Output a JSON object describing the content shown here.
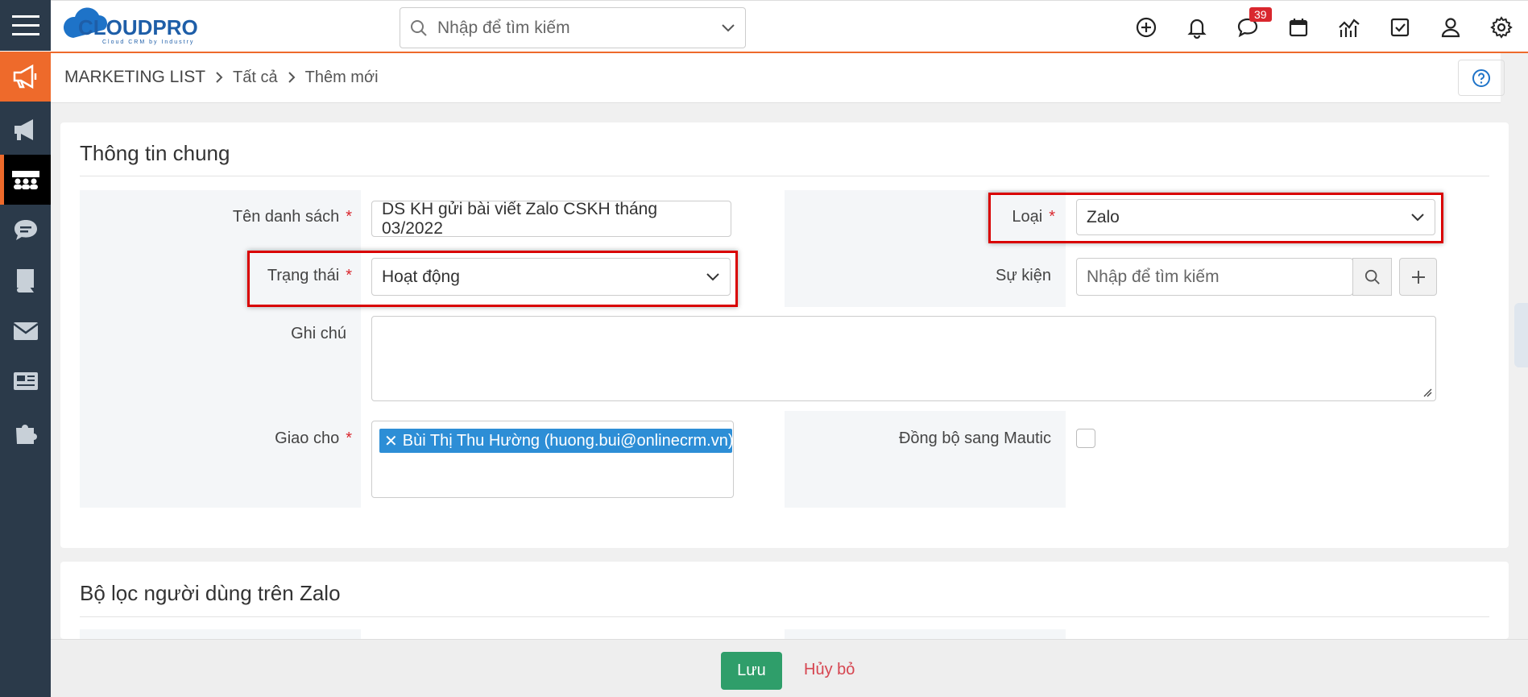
{
  "app": {
    "logo_text": "CLOUDPRO",
    "logo_tagline": "Cloud CRM by Industry",
    "brand_color": "#ee6a2b"
  },
  "header": {
    "search_placeholder": "Nhập để tìm kiếm",
    "notification_count": "39",
    "icons": [
      "plus-circle-icon",
      "bell-icon",
      "chat-icon",
      "calendar-icon",
      "chart-icon",
      "checkbox-icon",
      "user-icon",
      "gear-icon"
    ]
  },
  "breadcrumb": {
    "module": "MARKETING LIST",
    "level1": "Tất cả",
    "level2": "Thêm mới"
  },
  "general_section": {
    "title": "Thông tin chung",
    "list_name_label": "Tên danh sách",
    "list_name_value": "DS KH gửi bài viết Zalo CSKH tháng 03/2022",
    "type_label": "Loại",
    "type_value": "Zalo",
    "status_label": "Trạng thái",
    "status_value": "Hoạt động",
    "event_label": "Sự kiện",
    "event_placeholder": "Nhập để tìm kiếm",
    "note_label": "Ghi chú",
    "assign_label": "Giao cho",
    "assign_value": "Bùi Thị Thu Hường (huong.bui@onlinecrm.vn)",
    "sync_label": "Đồng bộ sang Mautic"
  },
  "filter_section": {
    "title": "Bộ lọc người dùng trên Zalo"
  },
  "footer": {
    "save_label": "Lưu",
    "cancel_label": "Hủy bỏ"
  }
}
